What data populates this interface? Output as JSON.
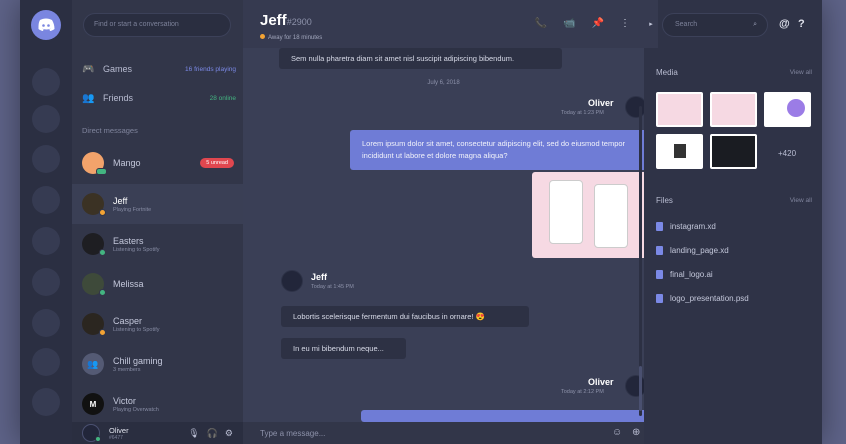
{
  "sidebar": {
    "search_placeholder": "Find or start a conversation",
    "nav": [
      {
        "label": "Games",
        "badge": "16 friends playing",
        "badge_color": "#7b89e6"
      },
      {
        "label": "Friends",
        "badge": "28 online",
        "badge_color": "#43b581"
      }
    ],
    "dm_header": "Direct messages",
    "dms": [
      {
        "name": "Mango",
        "sub": "",
        "badge": "5 unread"
      },
      {
        "name": "Jeff",
        "sub": "Playing Fortnite"
      },
      {
        "name": "Easters",
        "sub": "Listening to Spotify"
      },
      {
        "name": "Melissa",
        "sub": ""
      },
      {
        "name": "Casper",
        "sub": "Listening to Spotify"
      },
      {
        "name": "Chill gaming",
        "sub": "3 members"
      },
      {
        "name": "Victor",
        "sub": "Playing Overwatch"
      }
    ],
    "user": {
      "name": "Oliver",
      "tag": "#6477"
    }
  },
  "chat": {
    "name": "Jeff",
    "tag": "#2900",
    "status": "Away for 18 minutes",
    "messages": {
      "m1": "Sem nulla pharetra diam sit amet nisl suscipit adipiscing bibendum.",
      "day": "July 6, 2018",
      "oliver_name": "Oliver",
      "oliver_time1": "Today at 1:23 PM",
      "m2": "Lorem ipsum dolor sit amet, consectetur adipiscing elit, sed do eiusmod tempor incididunt ut labore et dolore magna aliqua?",
      "jeff_name": "Jeff",
      "jeff_time": "Today at 1:45 PM",
      "m3": "Lobortis scelerisque fermentum dui faucibus in ornare!",
      "m3_emoji": "😍",
      "m4": "In eu mi bibendum neque...",
      "oliver_time2": "Today at 2:12 PM"
    },
    "composer_placeholder": "Type a message..."
  },
  "right": {
    "search_placeholder": "Search",
    "media_label": "Media",
    "files_label": "Files",
    "view_all": "View all",
    "more_count": "+420",
    "files": [
      "instagram.xd",
      "landing_page.xd",
      "final_logo.ai",
      "logo_presentation.psd"
    ]
  },
  "colors": {
    "accent": "#7b89e6",
    "bubble_me": "#6f7cd6",
    "unread": "#e0474f",
    "online": "#43b581",
    "away": "#f3a334"
  }
}
